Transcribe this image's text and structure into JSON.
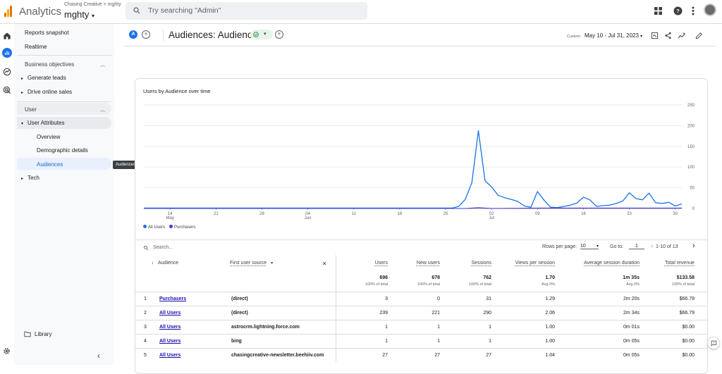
{
  "topbar": {
    "app_name": "Analytics",
    "account_crumb": "Chasing Creative > mghty",
    "property_name": "mghty",
    "search_placeholder": "Try searching \"Admin\""
  },
  "sidebar": {
    "reports_snapshot": "Reports snapshot",
    "realtime": "Realtime",
    "business_objectives": "Business objectives",
    "generate_leads": "Generate leads",
    "drive_online_sales": "Drive online sales",
    "user": "User",
    "user_attributes": "User Attributes",
    "overview": "Overview",
    "demographic_details": "Demographic details",
    "audiences": "Audiences",
    "tech": "Tech",
    "library": "Library",
    "tooltip": "Audiences"
  },
  "header": {
    "compare_chip": "A",
    "title": "Audiences: Audience",
    "custom_label": "Custom",
    "date_range": "May 10 - Jul 31, 2023"
  },
  "chart_data": {
    "type": "line",
    "title": "Users by Audience over time",
    "x_ticks": [
      "14\nMay",
      "21",
      "28",
      "04\nJun",
      "11",
      "18",
      "25",
      "02\nJul",
      "09",
      "16",
      "23",
      "30"
    ],
    "y_ticks": [
      0,
      50,
      100,
      150,
      200,
      250
    ],
    "ylim": [
      0,
      250
    ],
    "x_start": "2023-05-10",
    "x_end": "2023-07-31",
    "series": [
      {
        "name": "All Users",
        "color": "#1a73e8",
        "points": [
          [
            "2023-05-10",
            1
          ],
          [
            "2023-05-20",
            1
          ],
          [
            "2023-06-01",
            1
          ],
          [
            "2023-06-15",
            1
          ],
          [
            "2023-06-26",
            1
          ],
          [
            "2023-06-27",
            5
          ],
          [
            "2023-06-28",
            22
          ],
          [
            "2023-06-29",
            62
          ],
          [
            "2023-06-30",
            188
          ],
          [
            "2023-07-01",
            67
          ],
          [
            "2023-07-02",
            52
          ],
          [
            "2023-07-03",
            32
          ],
          [
            "2023-07-04",
            26
          ],
          [
            "2023-07-05",
            22
          ],
          [
            "2023-07-06",
            17
          ],
          [
            "2023-07-07",
            6
          ],
          [
            "2023-07-08",
            3
          ],
          [
            "2023-07-09",
            41
          ],
          [
            "2023-07-10",
            20
          ],
          [
            "2023-07-11",
            3
          ],
          [
            "2023-07-12",
            2
          ],
          [
            "2023-07-13",
            5
          ],
          [
            "2023-07-14",
            8
          ],
          [
            "2023-07-15",
            13
          ],
          [
            "2023-07-16",
            27
          ],
          [
            "2023-07-17",
            21
          ],
          [
            "2023-07-18",
            5
          ],
          [
            "2023-07-19",
            7
          ],
          [
            "2023-07-20",
            8
          ],
          [
            "2023-07-21",
            12
          ],
          [
            "2023-07-22",
            18
          ],
          [
            "2023-07-23",
            38
          ],
          [
            "2023-07-24",
            24
          ],
          [
            "2023-07-25",
            21
          ],
          [
            "2023-07-26",
            37
          ],
          [
            "2023-07-27",
            14
          ],
          [
            "2023-07-28",
            12
          ],
          [
            "2023-07-29",
            15
          ],
          [
            "2023-07-30",
            6
          ],
          [
            "2023-07-31",
            11
          ]
        ]
      },
      {
        "name": "Purchasers",
        "color": "#3c3bd6",
        "points": [
          [
            "2023-05-10",
            0
          ],
          [
            "2023-06-28",
            0
          ],
          [
            "2023-06-30",
            2
          ],
          [
            "2023-07-02",
            0
          ],
          [
            "2023-07-09",
            1
          ],
          [
            "2023-07-16",
            1
          ],
          [
            "2023-07-24",
            1
          ],
          [
            "2023-07-31",
            1
          ]
        ]
      }
    ]
  },
  "legend": {
    "all_users": "All Users",
    "purchasers": "Purchasers"
  },
  "table_controls": {
    "search_placeholder": "Search...",
    "rows_per_page_label": "Rows per page:",
    "rows_per_page": "10",
    "goto_label": "Go to:",
    "goto_value": "1",
    "range": "1-10 of 13"
  },
  "table": {
    "headers": {
      "audience": "Audience",
      "source": "First user source",
      "users": "Users",
      "new_users": "New users",
      "sessions": "Sessions",
      "views_per_session": "Views per session",
      "avg_session_duration": "Average session duration",
      "total_revenue": "Total revenue"
    },
    "totals": {
      "users": "696",
      "users_sub": "100% of total",
      "new_users": "678",
      "new_users_sub": "100% of total",
      "sessions": "762",
      "sessions_sub": "100% of total",
      "views_per_session": "1.70",
      "views_per_session_sub": "Avg 0%",
      "avg_session_duration": "1m 35s",
      "avg_session_duration_sub": "Avg 0%",
      "total_revenue": "$133.58",
      "total_revenue_sub": "100% of total"
    },
    "rows": [
      {
        "idx": "1",
        "audience": "Purchasers",
        "source": "(direct)",
        "users": "3",
        "new_users": "0",
        "sessions": "31",
        "vps": "1.29",
        "asd": "2m 20s",
        "revenue": "$66.79"
      },
      {
        "idx": "2",
        "audience": "All Users",
        "source": "(direct)",
        "users": "239",
        "new_users": "221",
        "sessions": "290",
        "vps": "2.06",
        "asd": "2m 34s",
        "revenue": "$66.79"
      },
      {
        "idx": "3",
        "audience": "All Users",
        "source": "astrocrm.lightning.force.com",
        "users": "1",
        "new_users": "1",
        "sessions": "1",
        "vps": "1.00",
        "asd": "0m 01s",
        "revenue": "$0.00"
      },
      {
        "idx": "4",
        "audience": "All Users",
        "source": "bing",
        "users": "1",
        "new_users": "1",
        "sessions": "1",
        "vps": "1.00",
        "asd": "0m 05s",
        "revenue": "$0.00"
      },
      {
        "idx": "5",
        "audience": "All Users",
        "source": "chasingcreative-newsletter.beehiiv.com",
        "users": "27",
        "new_users": "27",
        "sessions": "27",
        "vps": "1.04",
        "asd": "0m 05s",
        "revenue": "$0.00"
      }
    ]
  }
}
